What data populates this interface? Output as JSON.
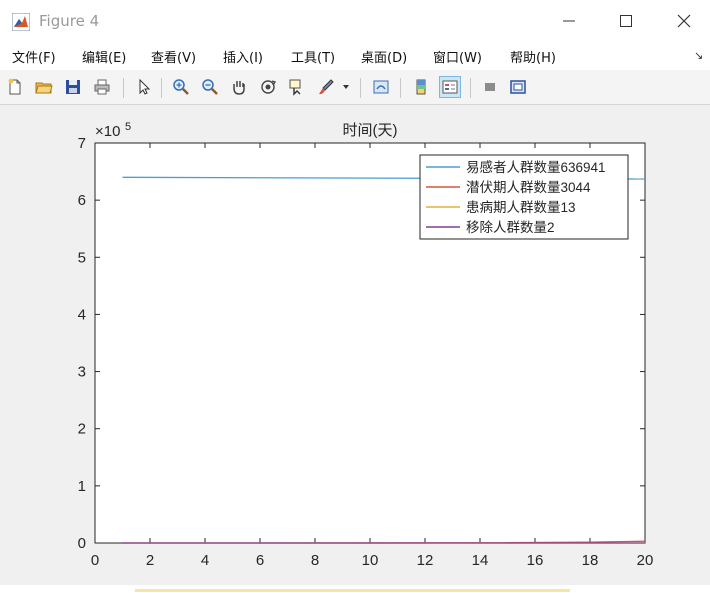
{
  "window": {
    "title": "Figure 4"
  },
  "menu": [
    "文件(F)",
    "编辑(E)",
    "查看(V)",
    "插入(I)",
    "工具(T)",
    "桌面(D)",
    "窗口(W)",
    "帮助(H)"
  ],
  "toolbar": {
    "icons": [
      "new-figure-icon",
      "open-file-icon",
      "save-icon",
      "print-icon",
      "pointer-icon",
      "zoom-in-icon",
      "zoom-out-icon",
      "pan-icon",
      "rotate-3d-icon",
      "data-cursor-icon",
      "brush-icon",
      "link-plot-icon",
      "insert-colorbar-icon",
      "insert-legend-icon",
      "hide-plot-tools-icon",
      "show-plot-tools-icon"
    ]
  },
  "chart_data": {
    "type": "line",
    "title": "时间(天)",
    "xlabel": "",
    "ylabel": "",
    "exponent_label": "×10",
    "exponent_power": "5",
    "xlim": [
      0,
      20
    ],
    "ylim": [
      0,
      700000
    ],
    "x_ticks": [
      "0",
      "2",
      "4",
      "6",
      "8",
      "10",
      "12",
      "14",
      "16",
      "18",
      "20"
    ],
    "y_ticks": [
      "0",
      "1",
      "2",
      "3",
      "4",
      "5",
      "6",
      "7"
    ],
    "legend_position": "top-right",
    "series": [
      {
        "name": "易感者人群数量636941",
        "color": "#4a9fd0",
        "x": [
          1,
          20
        ],
        "y": [
          640000,
          636941
        ]
      },
      {
        "name": "潜伏期人群数量3044",
        "color": "#d9533b",
        "x": [
          1,
          10,
          15,
          18,
          20
        ],
        "y": [
          0,
          80,
          500,
          1500,
          3044
        ]
      },
      {
        "name": "患病期人群数量13",
        "color": "#e2b13a",
        "x": [
          1,
          20
        ],
        "y": [
          0,
          13
        ]
      },
      {
        "name": "移除人群数量2",
        "color": "#7e3f98",
        "x": [
          1,
          20
        ],
        "y": [
          0,
          2
        ]
      }
    ]
  }
}
